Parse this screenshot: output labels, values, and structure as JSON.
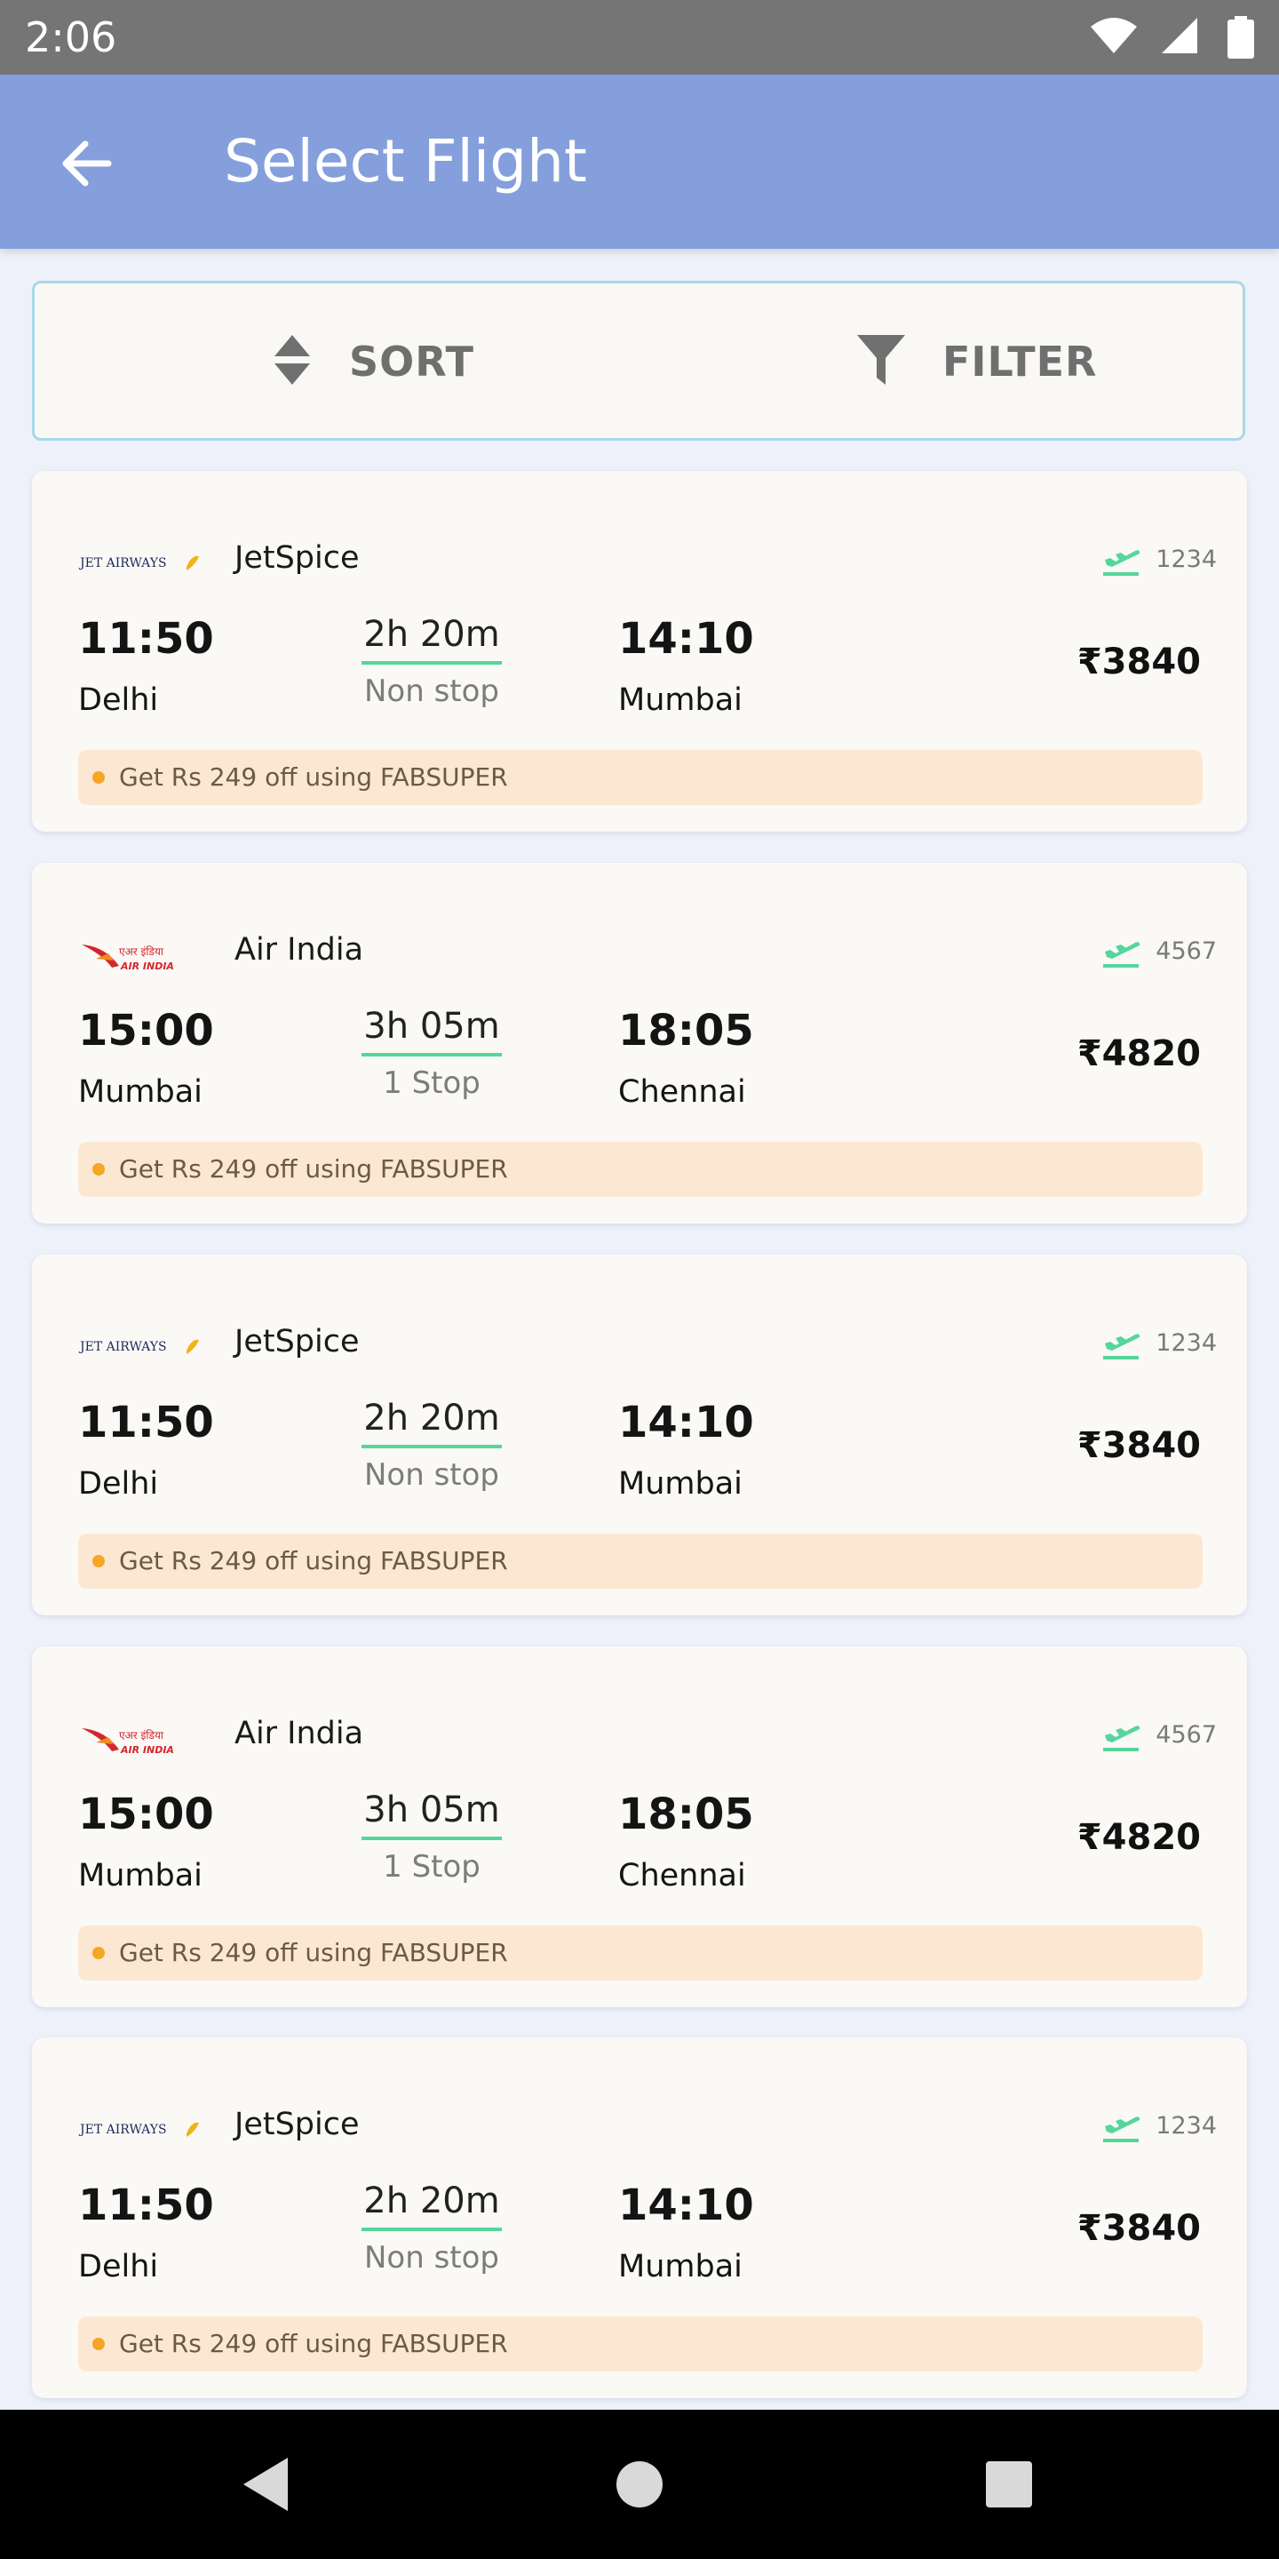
{
  "status_bar": {
    "time": "2:06"
  },
  "app_bar": {
    "title": "Select Flight"
  },
  "sort_filter": {
    "sort_label": "SORT",
    "filter_label": "FILTER"
  },
  "flights": [
    {
      "airline": "JetSpice",
      "logo": "jet-airways-logo",
      "logo_text": "JET AIRWAYS",
      "flight_number": "1234",
      "dep_time": "11:50",
      "dep_city": "Delhi",
      "duration": "2h 20m",
      "stops": "Non stop",
      "arr_time": "14:10",
      "arr_city": "Mumbai",
      "price": "₹3840",
      "offer": "Get Rs 249 off using FABSUPER"
    },
    {
      "airline": "Air India",
      "logo": "air-india-logo",
      "logo_text": "AIR INDIA",
      "flight_number": "4567",
      "dep_time": "15:00",
      "dep_city": "Mumbai",
      "duration": "3h 05m",
      "stops": "1 Stop",
      "arr_time": "18:05",
      "arr_city": "Chennai",
      "price": "₹4820",
      "offer": "Get Rs 249 off using FABSUPER"
    },
    {
      "airline": "JetSpice",
      "logo": "jet-airways-logo",
      "logo_text": "JET AIRWAYS",
      "flight_number": "1234",
      "dep_time": "11:50",
      "dep_city": "Delhi",
      "duration": "2h 20m",
      "stops": "Non stop",
      "arr_time": "14:10",
      "arr_city": "Mumbai",
      "price": "₹3840",
      "offer": "Get Rs 249 off using FABSUPER"
    },
    {
      "airline": "Air India",
      "logo": "air-india-logo",
      "logo_text": "AIR INDIA",
      "flight_number": "4567",
      "dep_time": "15:00",
      "dep_city": "Mumbai",
      "duration": "3h 05m",
      "stops": "1 Stop",
      "arr_time": "18:05",
      "arr_city": "Chennai",
      "price": "₹4820",
      "offer": "Get Rs 249 off using FABSUPER"
    },
    {
      "airline": "JetSpice",
      "logo": "jet-airways-logo",
      "logo_text": "JET AIRWAYS",
      "flight_number": "1234",
      "dep_time": "11:50",
      "dep_city": "Delhi",
      "duration": "2h 20m",
      "stops": "Non stop",
      "arr_time": "14:10",
      "arr_city": "Mumbai",
      "price": "₹3840",
      "offer": "Get Rs 249 off using FABSUPER"
    }
  ],
  "colors": {
    "app_bar": "#849fdc",
    "accent_green": "#55d69a",
    "offer_bg": "#fce8d2",
    "offer_dot": "#f5a623"
  },
  "icons": {
    "back": "arrow-left-icon",
    "sort": "sort-icon",
    "filter": "filter-icon",
    "flight": "plane-takeoff-icon",
    "wifi": "wifi-icon",
    "signal": "signal-icon",
    "battery": "battery-icon",
    "nav_back": "triangle-back-icon",
    "nav_home": "circle-home-icon",
    "nav_recents": "square-recents-icon"
  }
}
